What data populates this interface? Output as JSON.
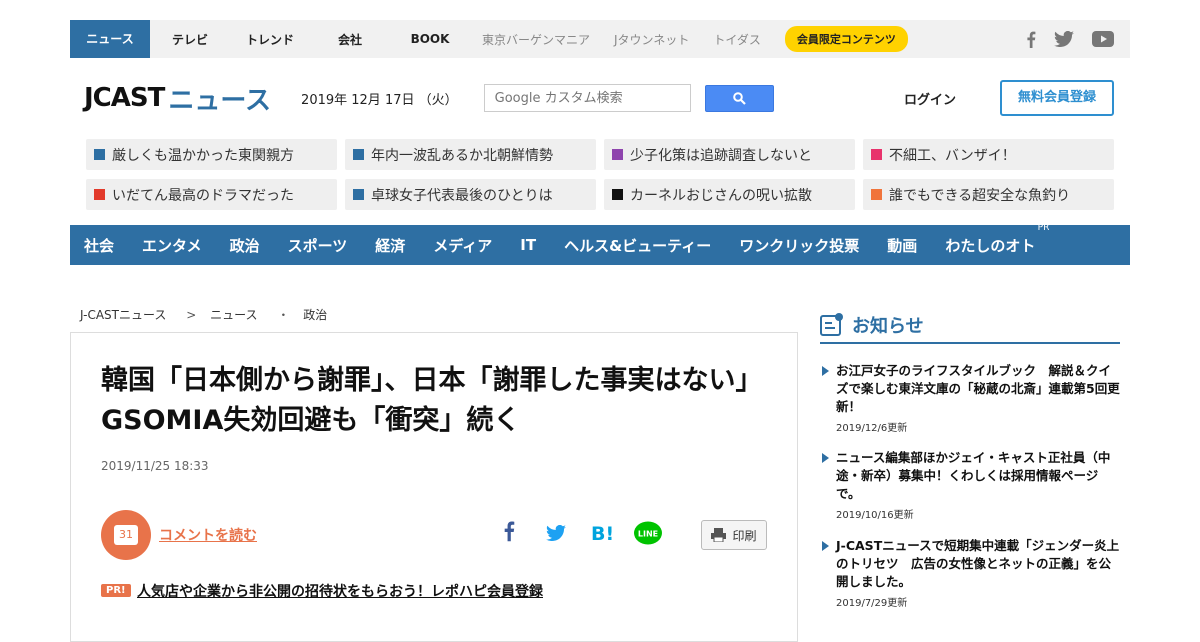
{
  "topnav": {
    "items": [
      "ニュース",
      "テレビ",
      "トレンド",
      "会社",
      "BOOK"
    ],
    "sub_items": [
      "東京バーゲンマニア",
      "Jタウンネット",
      "トイダス"
    ],
    "member_label": "会員限定コンテンツ"
  },
  "header": {
    "logo_jcast": "JCAST",
    "logo_news": "ニュース",
    "date": "2019年 12月 17日 （火）",
    "search_placeholder": "Google カスタム検索",
    "login_label": "ログイン",
    "register_label": "無料会員登録"
  },
  "topics": [
    {
      "label": "厳しくも温かかった東関親方",
      "color": "#2e6fa3"
    },
    {
      "label": "年内一波乱あるか北朝鮮情勢",
      "color": "#2e6fa3"
    },
    {
      "label": "少子化策は追跡調査しないと",
      "color": "#8e44ad"
    },
    {
      "label": "不細工、バンザイ！",
      "color": "#e8326c"
    },
    {
      "label": "いだてん最高のドラマだった",
      "color": "#e23a2b"
    },
    {
      "label": "卓球女子代表最後のひとりは",
      "color": "#2e6fa3"
    },
    {
      "label": "カーネルおじさんの呪い拡散",
      "color": "#111111"
    },
    {
      "label": "誰でもできる超安全な魚釣り",
      "color": "#f0743b"
    }
  ],
  "catnav": {
    "items": [
      "社会",
      "エンタメ",
      "政治",
      "スポーツ",
      "経済",
      "メディア",
      "IT",
      "ヘルス&ビューティー",
      "ワンクリック投票",
      "動画",
      "わたしのオト"
    ],
    "pr_label": "PR"
  },
  "breadcrumb": [
    "J-CASTニュース",
    ">",
    "ニュース",
    "・",
    "政治"
  ],
  "article": {
    "headline": "韓国「日本側から謝罪」、日本「謝罪した事実はない」　GSOMIA失効回避も「衝突」続く",
    "date": "2019/11/25 18:33",
    "comment_count": "31",
    "comment_label": "コメントを読む",
    "print_label": "印刷",
    "pr_badge": "PR!",
    "pr_text": "人気店や企業から非公開の招待状をもらおう！レポハピ会員登録"
  },
  "sidebar": {
    "title": "お知らせ",
    "notices": [
      {
        "text": "お江戸女子のライフスタイルブック　解説＆クイズで楽しむ東洋文庫の「秘蔵の北斎」連載第5回更新！",
        "date": "2019/12/6更新"
      },
      {
        "text": "ニュース編集部ほかジェイ・キャスト正社員（中途・新卒）募集中！くわしくは採用情報ページで。",
        "date": "2019/10/16更新"
      },
      {
        "text": "J-CASTニュースで短期集中連載「ジェンダー炎上のトリセツ　広告の女性像とネットの正義」を公開しました。",
        "date": "2019/7/29更新"
      }
    ]
  },
  "colors": {
    "brand_blue": "#2e6fa3",
    "accent_orange": "#e8734a",
    "member_yellow": "#ffd200"
  }
}
